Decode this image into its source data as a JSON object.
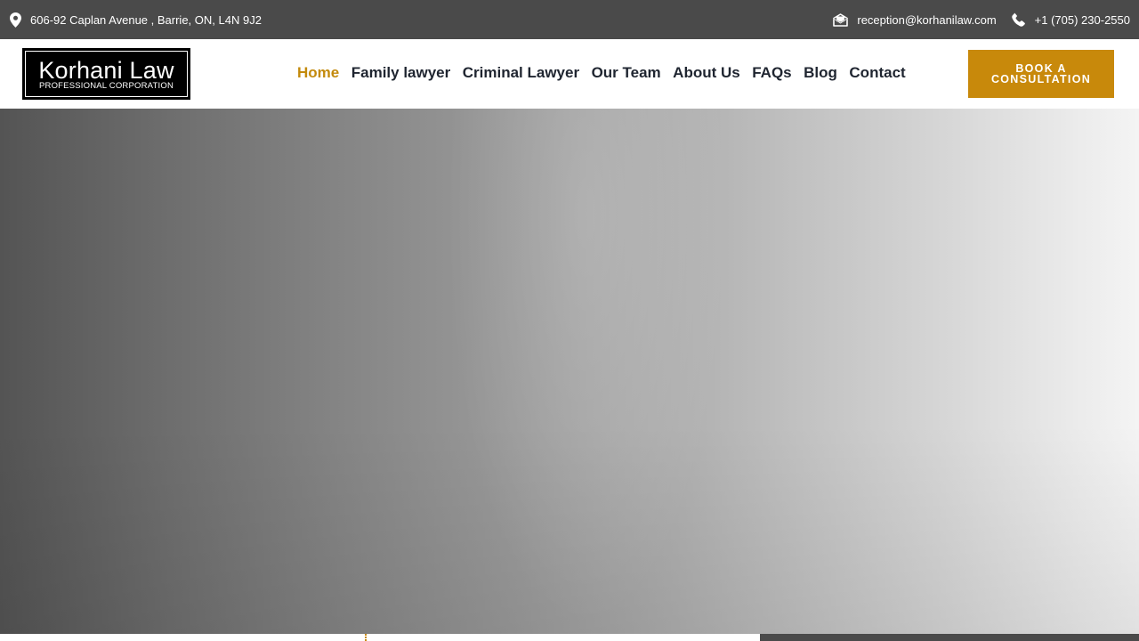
{
  "topbar": {
    "address": "606-92 Caplan Avenue , Barrie, ON, L4N 9J2",
    "address_icon": "map-pin-icon",
    "email": "reception@korhanilaw.com",
    "email_icon": "envelope-icon",
    "phone": "+1 (705) 230-2550",
    "phone_icon": "phone-icon"
  },
  "logo": {
    "title": "Korhani Law",
    "subtitle": "PROFESSIONAL CORPORATION"
  },
  "nav": {
    "items": [
      {
        "label": "Home",
        "active": true
      },
      {
        "label": "Family lawyer",
        "active": false
      },
      {
        "label": "Criminal Lawyer",
        "active": false
      },
      {
        "label": "Our Team",
        "active": false
      },
      {
        "label": "About Us",
        "active": false
      },
      {
        "label": "FAQs",
        "active": false
      },
      {
        "label": "Blog",
        "active": false
      },
      {
        "label": "Contact",
        "active": false
      }
    ]
  },
  "cta": {
    "label": "BOOK A CONSULTATION"
  },
  "colors": {
    "topbar_bg": "#4a4a4a",
    "accent": "#c8890b",
    "nav_text": "#1f2530"
  }
}
